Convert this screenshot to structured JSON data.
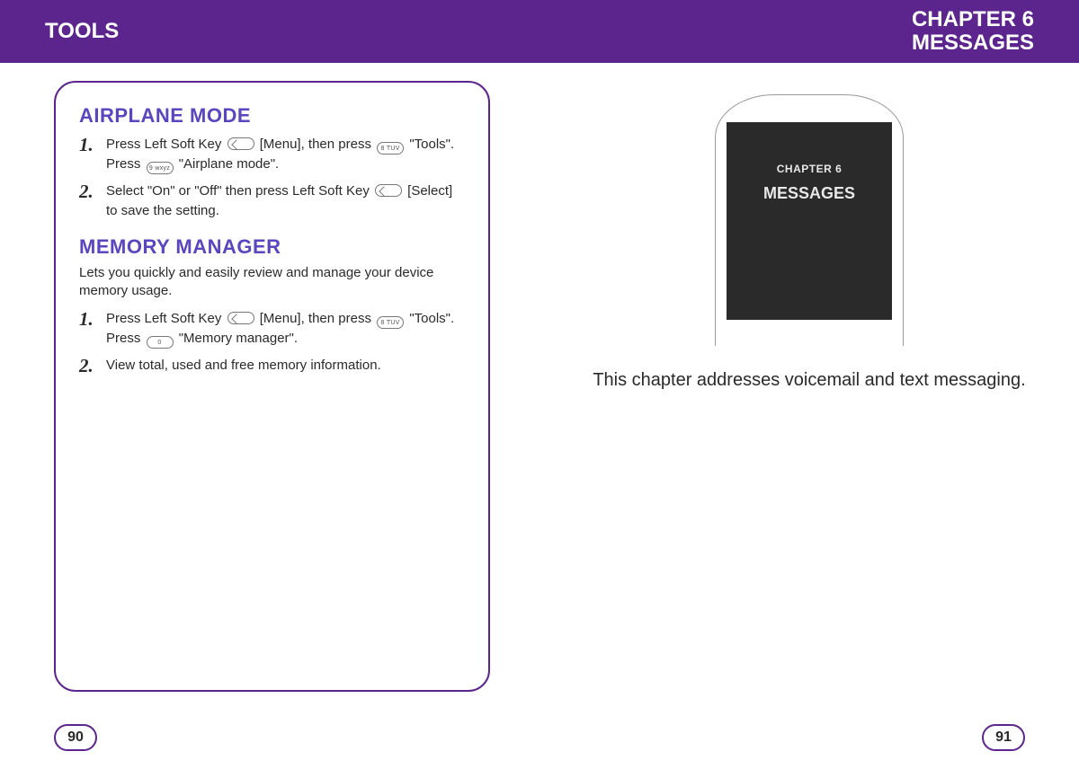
{
  "header": {
    "left": "TOOLS",
    "right_line1": "CHAPTER 6",
    "right_line2": "MESSAGES"
  },
  "panel": {
    "section_a": {
      "title": "AIRPLANE MODE",
      "step1a": "Press Left Soft Key ",
      "step1b": " [Menu], then press ",
      "step1c": " \"Tools\".",
      "step1d": "Press ",
      "step1e": " \"Airplane mode\".",
      "step2a": "Select \"On\" or \"Off\" then press Left Soft Key ",
      "step2b": " [Select] to save the setting."
    },
    "section_b": {
      "title": "MEMORY MANAGER",
      "subtitle": "Lets you quickly and easily review and manage your device memory usage.",
      "step1a": "Press Left Soft Key ",
      "step1b": " [Menu], then press ",
      "step1c": " \"Tools\".",
      "step1d": "Press ",
      "step1e": " \"Memory manager\".",
      "step2": "View total, used and free memory information."
    }
  },
  "keys": {
    "eight": "8 TUV",
    "nine": "9 wxyz",
    "zero": "0"
  },
  "right": {
    "screen_line1": "CHAPTER 6",
    "screen_line2": "MESSAGES",
    "blurb": "This chapter addresses voicemail and text messaging."
  },
  "pages": {
    "left": "90",
    "right": "91"
  }
}
